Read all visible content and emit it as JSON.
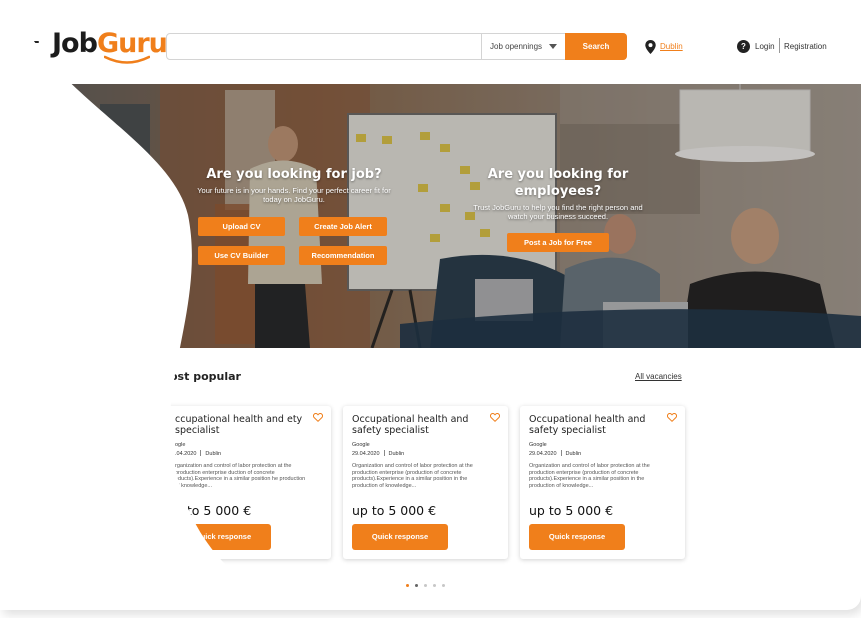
{
  "header": {
    "logo_job": "Job",
    "logo_guru": "Guru",
    "search": {
      "placeholder": "",
      "select_value": "Job opennings",
      "button": "Search"
    },
    "location": "Dublin",
    "help_icon": "?",
    "login": "Login",
    "registration": "Registration"
  },
  "hero": {
    "left": {
      "title": "Are you looking for job?",
      "subtitle": "Your future is in your hands. Find your perfect career fit for today on JobGuru.",
      "buttons": [
        "Upload CV",
        "Create Job Alert",
        "Use CV Builder",
        "Recommendation"
      ]
    },
    "right": {
      "title": "Are you looking for employees?",
      "subtitle": "Trust JobGuru to help you find the right person and watch your business succeed.",
      "button": "Post a Job for Free"
    }
  },
  "popular": {
    "title": "ost popular",
    "all_link": "All vacancies",
    "cards": [
      {
        "title": "ccupational health and ety specialist",
        "company": "ogle",
        "date": ".04.2020",
        "city": "Dublin",
        "description": "rganization and control of labor protection at the production enterprise duction of concrete oducts).Experience in a similar position he production of knowledge...",
        "salary": "p to 5 000 €",
        "button": "Quick response"
      },
      {
        "title": "Occupational health and safety specialist",
        "company": "Google",
        "date": "29.04.2020",
        "city": "Dublin",
        "description": "Organization and control of labor protection at the production enterprise (production of concrete products).Experience in a similar position in the production of knowledge...",
        "salary": "up to 5 000 €",
        "button": "Quick response"
      },
      {
        "title": "Occupational health and safety specialist",
        "company": "Google",
        "date": "29.04.2020",
        "city": "Dublin",
        "description": "Organization and control of labor protection at the production enterprise (production of concrete products).Experience in a similar position in the production of knowledge...",
        "salary": "up to 5 000 €",
        "button": "Quick response"
      }
    ]
  },
  "pagination": {
    "count": 5,
    "active": 1
  },
  "colors": {
    "accent": "#f07f1b",
    "text": "#222222",
    "background": "#ffffff"
  },
  "icons": [
    "hamburger-menu-icon",
    "location-pin-icon",
    "help-icon",
    "heart-icon",
    "dropdown-caret-icon"
  ]
}
